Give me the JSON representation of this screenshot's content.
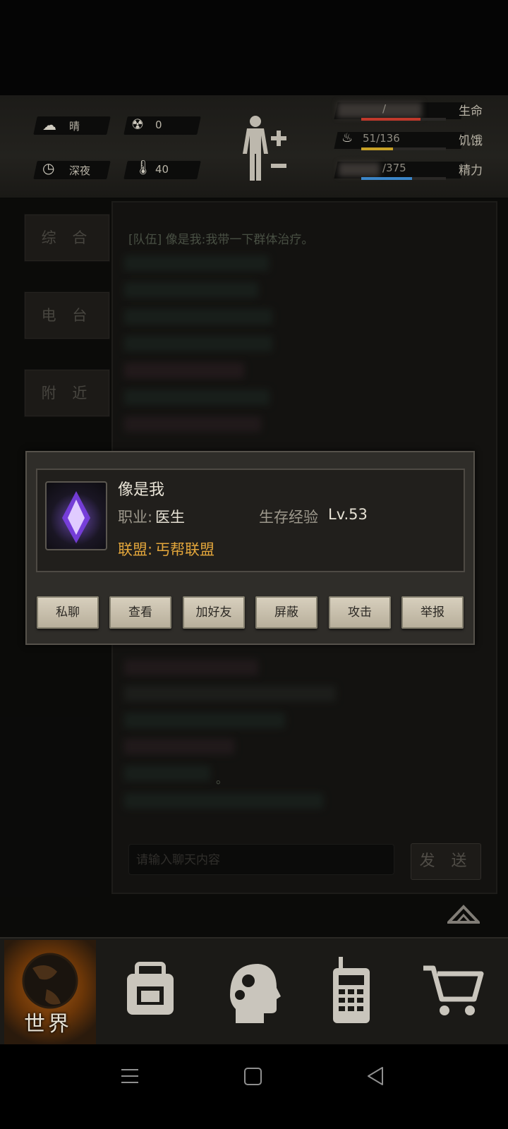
{
  "status": {
    "weather_label": "晴",
    "radiation_value": "0",
    "time_label": "深夜",
    "temperature_value": "40"
  },
  "vitals": {
    "life_label": "生命",
    "life_value": "/",
    "life_level": 0.7,
    "hunger_label": "饥饿",
    "hunger_value": "51/136",
    "hunger_level": 0.375,
    "stamina_label": "精力",
    "stamina_value": "/375",
    "stamina_level": 0.6
  },
  "side_tabs": [
    "综 合",
    "电 台",
    "附 近"
  ],
  "chat": {
    "messages": [
      {
        "text": "[队伍] 像是我:我带一下群体治疗。"
      },
      {
        "text": "。"
      }
    ],
    "input_placeholder": "请输入聊天内容",
    "send_label": "发 送"
  },
  "player_popup": {
    "name": "像是我",
    "profession_label": "职业:",
    "profession_value": "医生",
    "survival_label": "生存经验",
    "survival_value": "Lv.53",
    "union_label": "联盟:",
    "union_value": "丐帮联盟",
    "actions": [
      "私聊",
      "查看",
      "加好友",
      "屏蔽",
      "攻击",
      "举报"
    ]
  },
  "bottom_nav": {
    "world_label": "世界",
    "items": [
      "world-globe-icon",
      "backpack-icon",
      "skills-head-icon",
      "radio-phone-icon",
      "shop-cart-icon"
    ]
  }
}
